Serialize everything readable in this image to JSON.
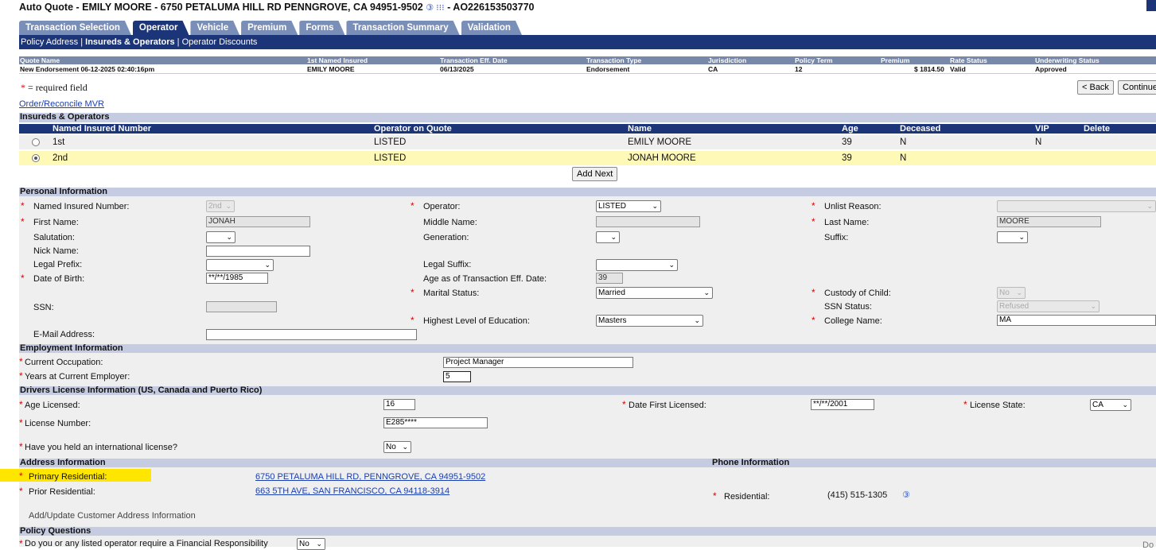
{
  "title": {
    "text": "Auto Quote - EMILY MOORE  - 6750 PETALUMA HILL RD PENNGROVE, CA 94951-9502",
    "icons": "③ ⁝⁝⁝",
    "quote_id": " - AO226153503770"
  },
  "tabs": [
    {
      "label": "Transaction Selection"
    },
    {
      "label": "Operator"
    },
    {
      "label": "Vehicle"
    },
    {
      "label": "Premium"
    },
    {
      "label": "Forms"
    },
    {
      "label": "Transaction Summary"
    },
    {
      "label": "Validation"
    }
  ],
  "subnav": {
    "policy_address": "Policy Address",
    "sep1": " | ",
    "insureds_operators": "Insureds & Operators",
    "sep2": " | ",
    "operator_discounts": "Operator Discounts"
  },
  "quote_summary": {
    "headers": [
      "Quote Name",
      "1st Named Insured",
      "Transaction Eff. Date",
      "Transaction Type",
      "Jurisdiction",
      "Policy Term",
      "Premium",
      "Rate Status",
      "Underwriting Status"
    ],
    "values": [
      "New Endorsement 06-12-2025 02:40:16pm",
      "EMILY MOORE",
      "06/13/2025",
      "Endorsement",
      "CA",
      "12",
      "$ 1814.50",
      "Valid",
      "Approved"
    ]
  },
  "required_note": {
    "star": "*",
    "text": " = required field"
  },
  "buttons": {
    "back": "< Back",
    "continue": "Continue",
    "add_next": "Add Next"
  },
  "order_mvr": "Order/Reconcile MVR",
  "insureds_section": {
    "title": "Insureds & Operators",
    "columns": [
      "Named Insured Number",
      "Operator on Quote",
      "Name",
      "Age",
      "Deceased",
      "VIP",
      "Delete"
    ],
    "rows": [
      {
        "number": "1st",
        "operator": "LISTED",
        "name": "EMILY MOORE",
        "age": "39",
        "deceased": "N",
        "vip": "N",
        "selected": false
      },
      {
        "number": "2nd",
        "operator": "LISTED",
        "name": "JONAH MOORE",
        "age": "39",
        "deceased": "N",
        "vip": "",
        "selected": true
      }
    ]
  },
  "personal": {
    "title": "Personal Information",
    "named_insured_number": {
      "label": "Named Insured Number:",
      "value": "2nd"
    },
    "operator": {
      "label": "Operator:",
      "value": "LISTED"
    },
    "unlist_reason": {
      "label": "Unlist Reason:",
      "value": ""
    },
    "first_name": {
      "label": "First Name:",
      "value": "JONAH"
    },
    "middle_name": {
      "label": "Middle Name:",
      "value": ""
    },
    "last_name": {
      "label": "Last Name:",
      "value": "MOORE"
    },
    "salutation": {
      "label": "Salutation:",
      "value": ""
    },
    "generation": {
      "label": "Generation:",
      "value": ""
    },
    "suffix": {
      "label": "Suffix:",
      "value": ""
    },
    "nick_name": {
      "label": "Nick Name:",
      "value": ""
    },
    "legal_prefix": {
      "label": "Legal Prefix:",
      "value": ""
    },
    "legal_suffix": {
      "label": "Legal Suffix:",
      "value": ""
    },
    "dob": {
      "label": "Date of Birth:",
      "value": "**/**/1985"
    },
    "age_as_of": {
      "label": "Age as of Transaction Eff. Date:",
      "value": "39"
    },
    "marital_status": {
      "label": "Marital Status:",
      "value": "Married"
    },
    "custody": {
      "label": "Custody of Child:",
      "value": "No"
    },
    "ssn": {
      "label": "SSN:",
      "value": ""
    },
    "ssn_status": {
      "label": "SSN Status:",
      "value": "Refused"
    },
    "education": {
      "label": "Highest Level of Education:",
      "value": "Masters"
    },
    "college": {
      "label": "College Name:",
      "value": "MA"
    },
    "email": {
      "label": "E-Mail Address:",
      "value": ""
    }
  },
  "employment": {
    "title": "Employment Information",
    "occupation": {
      "label": "Current Occupation:",
      "value": "Project Manager"
    },
    "years": {
      "label": "Years at Current Employer:",
      "value": "5"
    }
  },
  "license": {
    "title": "Drivers License Information (US, Canada and Puerto Rico)",
    "age_licensed": {
      "label": "Age Licensed:",
      "value": "16"
    },
    "date_first": {
      "label": "Date First Licensed:",
      "value": "**/**/2001"
    },
    "state": {
      "label": "License State:",
      "value": "CA"
    },
    "number": {
      "label": "License Number:",
      "value": "E285****"
    },
    "intl": {
      "label": "Have you held an international license?",
      "value": "No"
    }
  },
  "address": {
    "title": "Address Information",
    "primary": {
      "label": "Primary Residential:",
      "value": "6750 PETALUMA HILL RD,  PENNGROVE,  CA 94951-9502"
    },
    "prior": {
      "label": "Prior Residential:",
      "value": "663 5TH AVE,  SAN FRANCISCO,  CA 94118-3914"
    },
    "add_update": "Add/Update Customer Address Information"
  },
  "phone": {
    "title": "Phone Information",
    "residential": {
      "label": "Residential:",
      "value": "(415) 515-1305"
    }
  },
  "policy_questions": {
    "title": "Policy Questions",
    "financial": {
      "label": "Do you or any listed operator require a Financial Responsibility",
      "value": "No"
    },
    "cut_text": "Do"
  },
  "colors": {
    "nav_dark": "#1c3578",
    "tab_inactive": "#7a8fb8",
    "section": "#c5cbe0",
    "highlight": "#ffe600",
    "selected_row": "#fff9b8"
  }
}
